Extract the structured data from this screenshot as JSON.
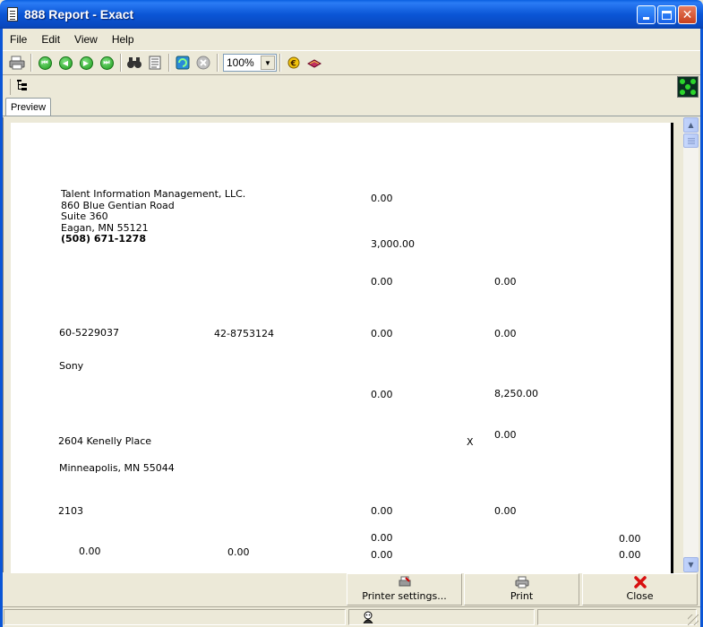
{
  "window": {
    "title": "888 Report - Exact"
  },
  "menu": {
    "items": [
      "File",
      "Edit",
      "View",
      "Help"
    ]
  },
  "toolbar": {
    "zoom_value": "100%",
    "icons": [
      "print-icon",
      "first-page-icon",
      "previous-page-icon",
      "next-page-icon",
      "last-page-icon",
      "find-icon",
      "page-setup-icon",
      "refresh-icon",
      "stop-icon",
      "export-icon",
      "book-icon"
    ]
  },
  "tabs": {
    "preview": "Preview"
  },
  "report": {
    "company_name": "Talent Information Management, LLC.",
    "address_line1": "860 Blue Gentian Road",
    "address_line2": "Suite 360",
    "address_line3": "Eagan, MN 55121",
    "phone": "(508) 671-1278",
    "payer_id": "60-5229037",
    "recipient_id": "42-8753124",
    "recipient_name": "Sony",
    "recipient_street": "2604 Kenelly Place",
    "recipient_city": "Minneapolis, MN 55044",
    "account_number": "2103",
    "checkbox_mark": "X",
    "amounts": {
      "a1": "0.00",
      "a2": "3,000.00",
      "a3": "0.00",
      "a4": "0.00",
      "a5": "0.00",
      "a6": "0.00",
      "a7": "0.00",
      "a8": "8,250.00",
      "a9": "0.00",
      "a10": "0.00",
      "a11": "0.00",
      "a12": "0.00",
      "a13": "0.00",
      "a14": "0.00",
      "a15": "0.00",
      "a16": "0.00",
      "a17": "0.00"
    }
  },
  "buttons": {
    "printer_settings": "Printer settings...",
    "print": "Print",
    "close": "Close"
  },
  "colors": {
    "title_bar": "#0b56d6",
    "window_bg": "#ece9d8",
    "close_red": "#c8401e",
    "nav_green": "#1c9c1c"
  }
}
